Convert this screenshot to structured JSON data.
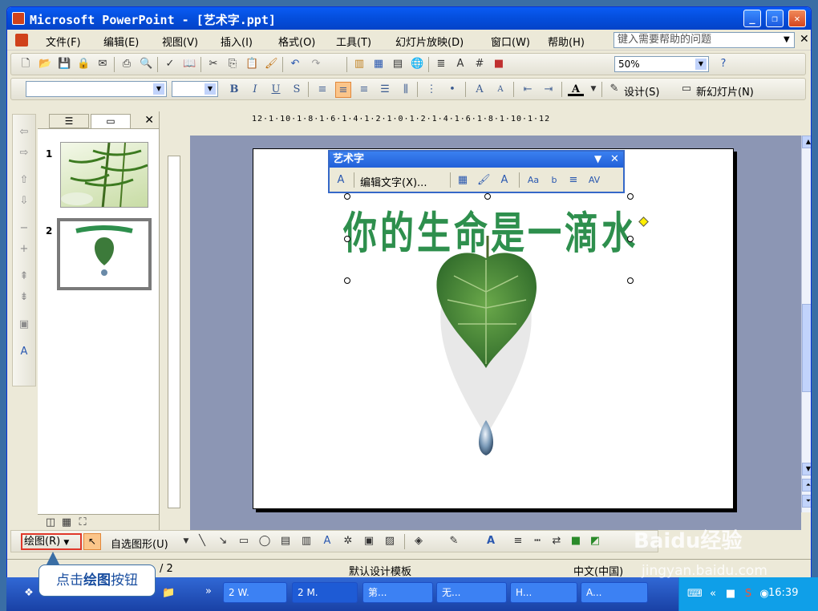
{
  "window": {
    "title": "Microsoft PowerPoint - [艺术字.ppt]",
    "controls": [
      "_",
      "❐",
      "✕"
    ]
  },
  "menu": {
    "items": [
      "文件(F)",
      "编辑(E)",
      "视图(V)",
      "插入(I)",
      "格式(O)",
      "工具(T)",
      "幻灯片放映(D)",
      "窗口(W)",
      "帮助(H)"
    ],
    "help_placeholder": "键入需要帮助的问题"
  },
  "standard_toolbar": {
    "zoom": "50%"
  },
  "format_toolbar": {
    "design_label": "设计(S)",
    "new_slide_label": "新幻灯片(N)"
  },
  "slide_panel": {
    "slide_numbers": [
      "1",
      "2"
    ]
  },
  "ruler": {
    "horizontal": "12·1·10·1·8·1·6·1·4·1·2·1·0·1·2·1·4·1·6·1·8·1·10·1·12"
  },
  "wordart_toolbar": {
    "title": "艺术字",
    "edit_text_label": "编辑文字(X)..."
  },
  "slide": {
    "wordart_text": "你的生命是一滴水"
  },
  "drawing_toolbar": {
    "draw_label": "绘图(R)",
    "autoshapes_label": "自选图形(U)"
  },
  "statusbar": {
    "slide_count": "/ 2",
    "template": "默认设计模板",
    "language": "中文(中国)"
  },
  "callout": {
    "prefix": "点击",
    "bold": "绘图",
    "suffix": "按钮"
  },
  "taskbar": {
    "items": [
      "2 W.",
      "2 M.",
      "第...",
      "无...",
      "H...",
      "A..."
    ],
    "clock": "16:39"
  },
  "watermark": {
    "main": "Baidu经验",
    "sub": "jingyan.baidu.com"
  },
  "colors": {
    "titlebar": "#0550e0",
    "wordart_green": "#2e8f4d",
    "highlight": "#fbc58a",
    "draw_button_border": "#e0382a"
  }
}
